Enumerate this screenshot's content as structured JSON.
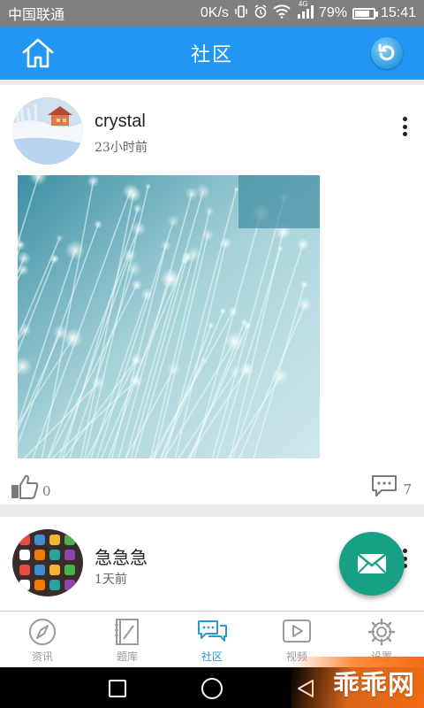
{
  "status_bar": {
    "carrier": "中国联通",
    "speed": "0K/s",
    "network": "4G",
    "battery": "79%",
    "battery_level": 0.79,
    "time": "15:41"
  },
  "header": {
    "title": "社区",
    "home_icon": "home-icon",
    "refresh_icon": "refresh-icon",
    "accent": "#2196f3"
  },
  "posts": [
    {
      "author": "crystal",
      "time": "23小时前",
      "avatar": "snow-cabin-avatar",
      "image": "fiber-optics-image",
      "likes": "0",
      "comments": "7"
    },
    {
      "author": "急急急",
      "time": "1天前",
      "avatar": "phone-apps-avatar"
    }
  ],
  "fab": {
    "icon": "envelope-icon",
    "color": "#16a085"
  },
  "tabs": [
    {
      "label": "资讯",
      "icon": "compass-icon"
    },
    {
      "label": "题库",
      "icon": "notebook-icon"
    },
    {
      "label": "社区",
      "icon": "chat-bubbles-icon",
      "active": true
    },
    {
      "label": "视频",
      "icon": "play-icon"
    },
    {
      "label": "设置",
      "icon": "gear-icon"
    }
  ],
  "watermark": "乖乖网"
}
